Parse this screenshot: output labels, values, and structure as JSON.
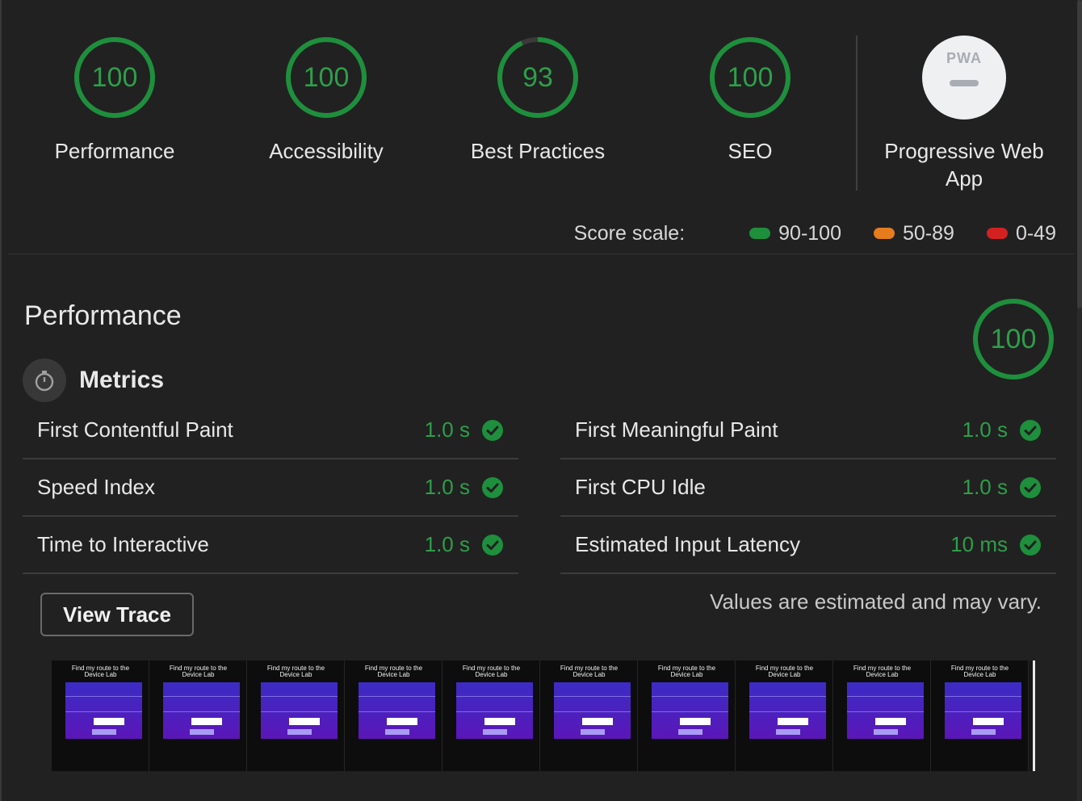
{
  "categories": [
    {
      "label": "Performance",
      "score": "100",
      "fraction": 1.0,
      "color": "#2e9e4a"
    },
    {
      "label": "Accessibility",
      "score": "100",
      "fraction": 1.0,
      "color": "#2e9e4a"
    },
    {
      "label": "Best Practices",
      "score": "93",
      "fraction": 0.93,
      "color": "#2e9e4a"
    },
    {
      "label": "SEO",
      "score": "100",
      "fraction": 1.0,
      "color": "#2e9e4a"
    }
  ],
  "pwa": {
    "badge_text": "PWA",
    "label_line1": "Progressive Web",
    "label_line2": "App"
  },
  "score_scale": {
    "title": "Score scale:",
    "items": [
      {
        "range": "90-100",
        "color": "#1e8f3c"
      },
      {
        "range": "50-89",
        "color": "#e67c1c"
      },
      {
        "range": "0-49",
        "color": "#d32121"
      }
    ]
  },
  "performance": {
    "title": "Performance",
    "score": "100",
    "fraction": 1.0,
    "metrics_title": "Metrics",
    "metrics_left": [
      {
        "name": "First Contentful Paint",
        "value": "1.0 s"
      },
      {
        "name": "Speed Index",
        "value": "1.0 s"
      },
      {
        "name": "Time to Interactive",
        "value": "1.0 s"
      }
    ],
    "metrics_right": [
      {
        "name": "First Meaningful Paint",
        "value": "1.0 s"
      },
      {
        "name": "First CPU Idle",
        "value": "1.0 s"
      },
      {
        "name": "Estimated Input Latency",
        "value": "10 ms"
      }
    ],
    "view_trace_label": "View Trace",
    "note": "Values are estimated and may vary."
  },
  "filmstrip": {
    "frame_count": 10,
    "frame_title_line1": "Find my route to the",
    "frame_title_line2": "Device Lab"
  },
  "colors": {
    "pass": "#2e9e4a",
    "background": "#212121"
  }
}
